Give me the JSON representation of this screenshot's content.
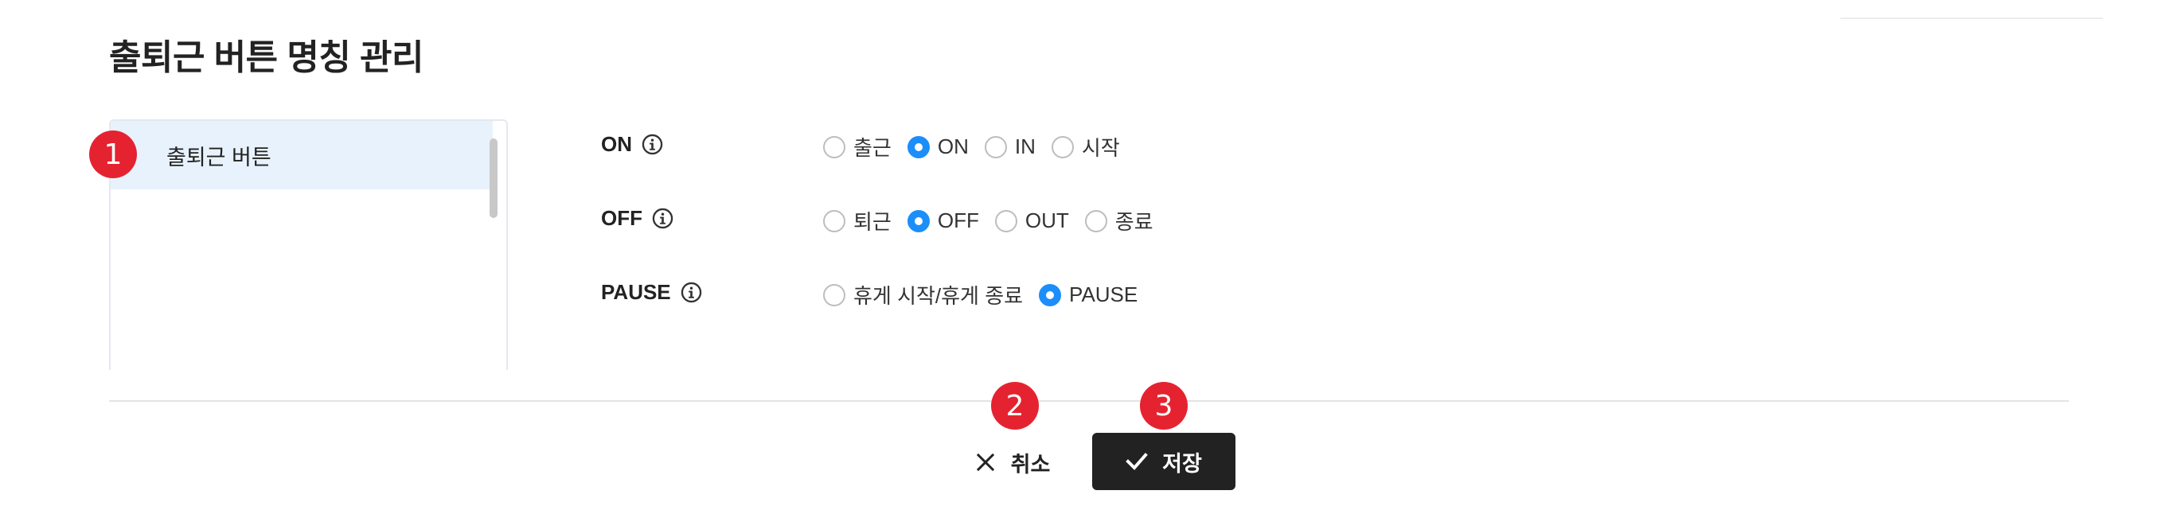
{
  "page_title": "출퇴근 버튼 명칭 관리",
  "list": {
    "items": [
      {
        "label": "출퇴근 버튼",
        "selected": true
      }
    ]
  },
  "markers": [
    "1",
    "2",
    "3"
  ],
  "settings": {
    "on": {
      "label": "ON",
      "options": [
        "출근",
        "ON",
        "IN",
        "시작"
      ],
      "selected": "ON"
    },
    "off": {
      "label": "OFF",
      "options": [
        "퇴근",
        "OFF",
        "OUT",
        "종료"
      ],
      "selected": "OFF"
    },
    "pause": {
      "label": "PAUSE",
      "options": [
        "휴게 시작/휴게 종료",
        "PAUSE"
      ],
      "selected": "PAUSE"
    }
  },
  "footer": {
    "cancel_label": "취소",
    "save_label": "저장"
  },
  "colors": {
    "accent": "#1c8ef9",
    "marker": "#e52330",
    "selected_row": "#e8f2fd",
    "save_button": "#222222"
  },
  "icons": {
    "info": "info-icon",
    "cancel": "close-icon",
    "save": "check-icon"
  }
}
